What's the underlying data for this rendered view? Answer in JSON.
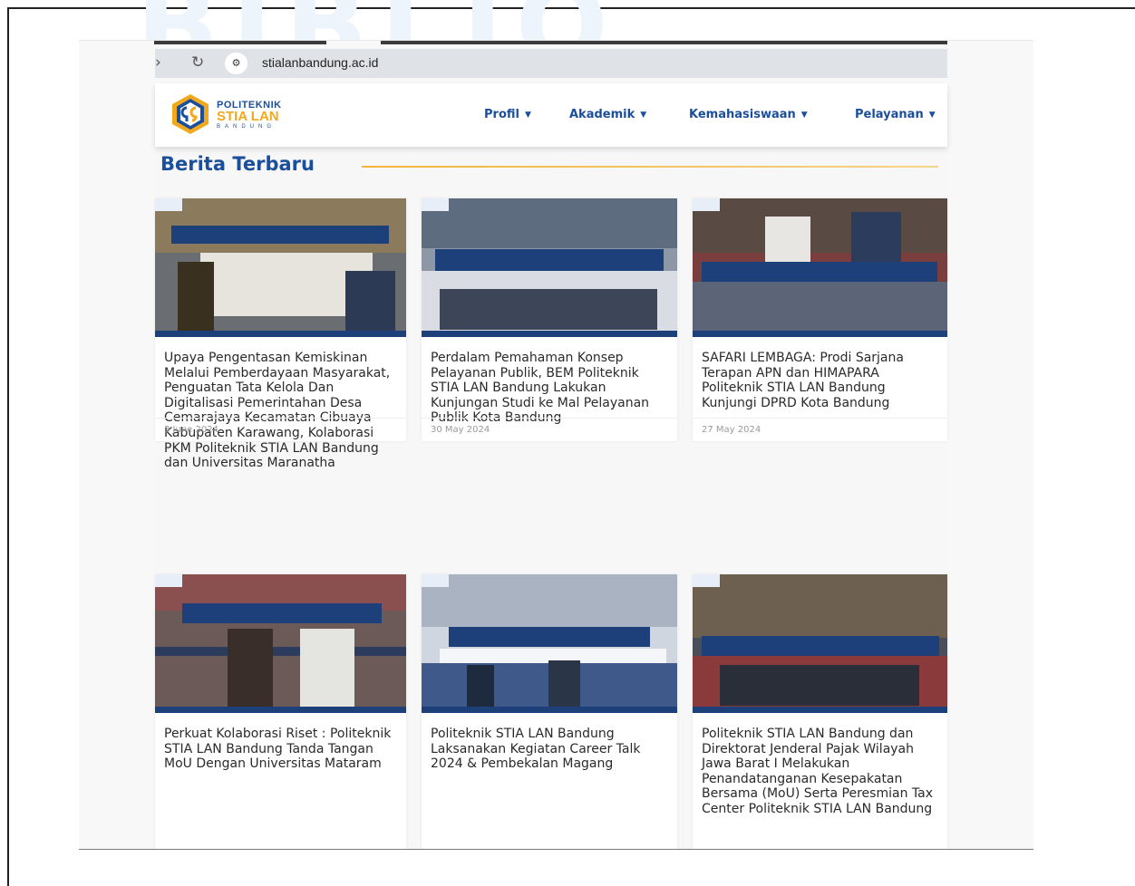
{
  "browser": {
    "back_icon": "arrow-right-icon",
    "reload_icon": "reload-icon",
    "url": "stialanbandung.ac.id"
  },
  "site": {
    "logo": {
      "line1": "POLITEKNIK",
      "line2": "STIA LAN",
      "line3": "BANDUNG"
    },
    "menu": [
      {
        "label": "Profil"
      },
      {
        "label": "Akademik"
      },
      {
        "label": "Kemahasiswaan"
      },
      {
        "label": "Pelayanan"
      }
    ],
    "brand_colors": {
      "primary": "#1b4f9b",
      "accent": "#f2a81d"
    }
  },
  "section": {
    "title": "Berita Terbaru"
  },
  "news": [
    {
      "title": "Upaya Pengentasan Kemiskinan Melalui Pemberdayaan Masyarakat, Penguatan Tata Kelola Dan Digitalisasi Pemerintahan Desa Cemarajaya Kecamatan Cibuaya Kabupaten Karawang, Kolaborasi PKM Politeknik STIA LAN Bandung dan Universitas Maranatha",
      "date": "3 June 2024"
    },
    {
      "title": "Perdalam Pemahaman Konsep Pelayanan Publik, BEM Politeknik STIA LAN Bandung Lakukan Kunjungan Studi ke Mal Pelayanan Publik Kota Bandung",
      "date": "30 May 2024"
    },
    {
      "title": "SAFARI LEMBAGA: Prodi Sarjana Terapan APN dan HIMAPARA Politeknik STIA LAN Bandung Kunjungi DPRD Kota Bandung",
      "date": "27 May 2024"
    },
    {
      "title": "Perkuat Kolaborasi Riset : Politeknik STIA LAN Bandung Tanda Tangan MoU Dengan Universitas Mataram",
      "date": ""
    },
    {
      "title": "Politeknik STIA LAN Bandung Laksanakan Kegiatan Career Talk 2024 & Pembekalan Magang",
      "date": ""
    },
    {
      "title": "Politeknik STIA LAN Bandung dan Direktorat Jenderal Pajak Wilayah Jawa Barat I Melakukan Penandatanganan Kesepakatan Bersama (MoU) Serta Peresmian Tax Center Politeknik STIA LAN Bandung",
      "date": ""
    }
  ]
}
